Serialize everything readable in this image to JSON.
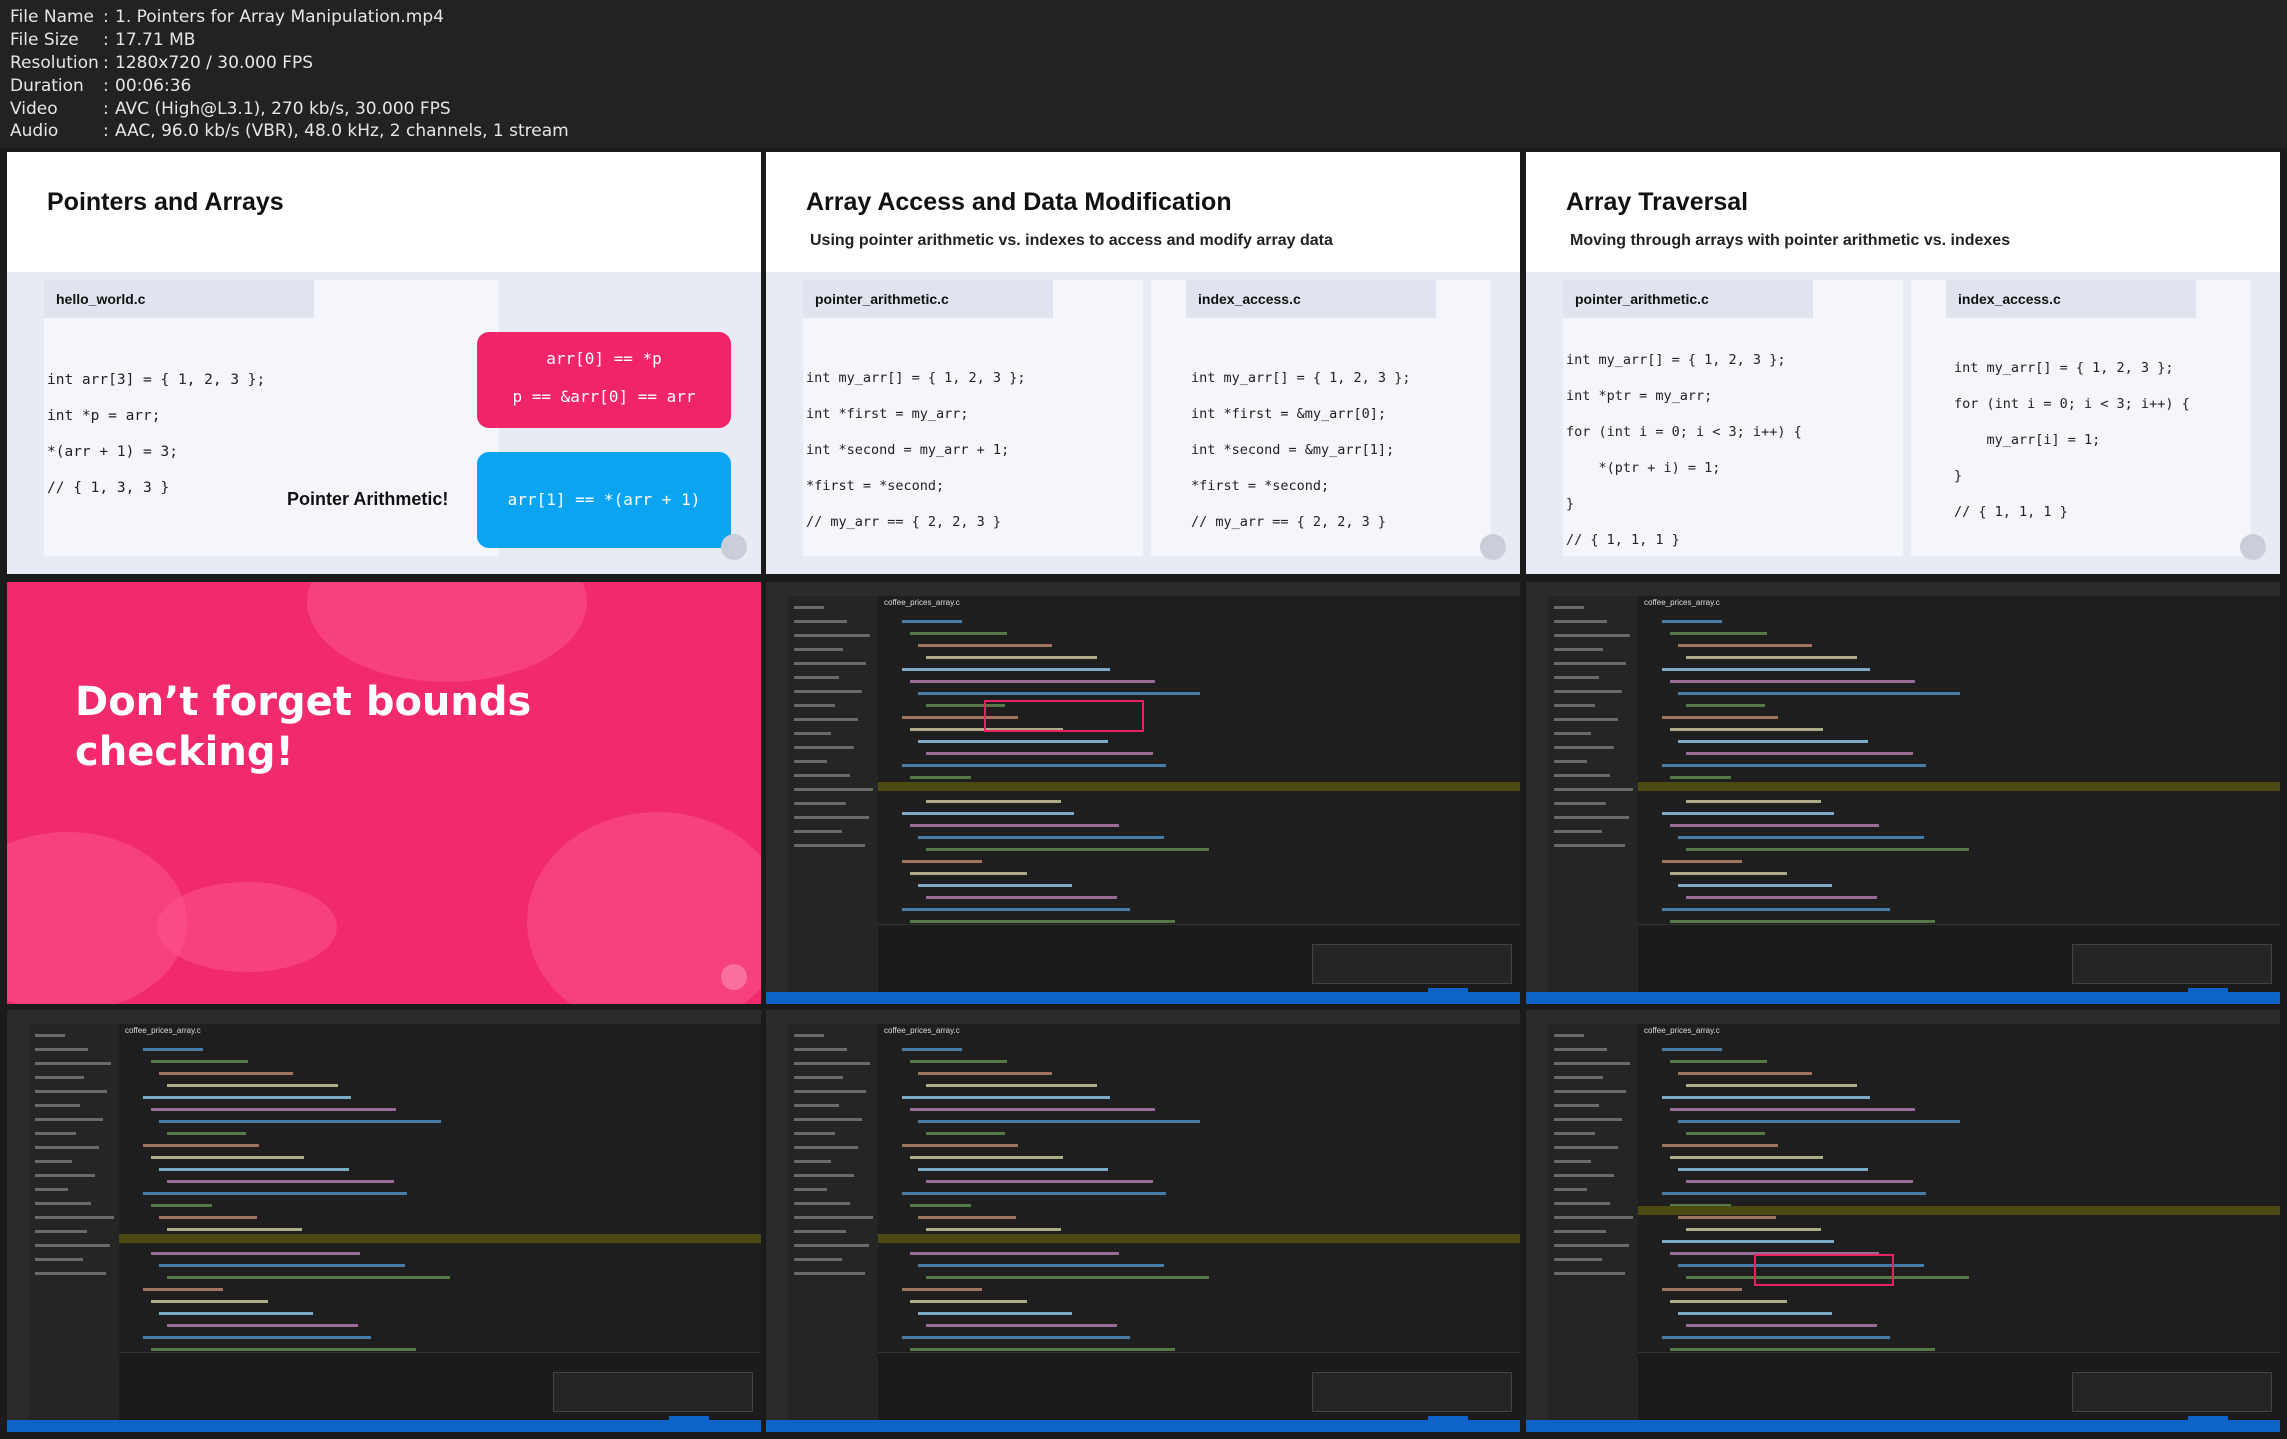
{
  "metadata": {
    "rows": [
      {
        "key": "File Name",
        "value": "1. Pointers for Array Manipulation.mp4"
      },
      {
        "key": "File Size",
        "value": "17.71 MB"
      },
      {
        "key": "Resolution",
        "value": "1280x720 / 30.000 FPS"
      },
      {
        "key": "Duration",
        "value": "00:06:36"
      },
      {
        "key": "Video",
        "value": "AVC (High@L3.1), 270 kb/s, 30.000 FPS"
      },
      {
        "key": "Audio",
        "value": "AAC, 96.0 kb/s (VBR), 48.0 kHz, 2 channels, 1 stream"
      }
    ]
  },
  "slide1": {
    "title": "Pointers and Arrays",
    "tab": "hello_world.c",
    "code": [
      "int arr[3] = { 1, 2, 3 };",
      "int *p = arr;",
      "*(arr + 1) = 3;",
      "// { 1, 3, 3 }"
    ],
    "box_pink_1": "arr[0] == *p",
    "box_pink_2": "p == &arr[0] == arr",
    "box_blue": "arr[1] == *(arr + 1)",
    "label": "Pointer Arithmetic!",
    "colors": {
      "pink": "#f0246a",
      "blue": "#0aa4f0"
    }
  },
  "slide2": {
    "title": "Array Access and Data Modification",
    "subtitle": "Using pointer arithmetic vs. indexes to access and modify array data",
    "tab_left": "pointer_arithmetic.c",
    "tab_right": "index_access.c",
    "code_left": [
      "int my_arr[] = { 1, 2, 3 };",
      "int *first = my_arr;",
      "int *second = my_arr + 1;",
      "*first = *second;",
      "// my_arr == { 2, 2, 3 }"
    ],
    "code_right": [
      "int my_arr[] = { 1, 2, 3 };",
      "int *first = &my_arr[0];",
      "int *second = &my_arr[1];",
      "*first = *second;",
      "// my_arr == { 2, 2, 3 }"
    ]
  },
  "slide3": {
    "title": "Array Traversal",
    "subtitle": "Moving through arrays with pointer arithmetic vs. indexes",
    "tab_left": "pointer_arithmetic.c",
    "tab_right": "index_access.c",
    "code_left": [
      "int my_arr[] = { 1, 2, 3 };",
      "int *ptr = my_arr;",
      "for (int i = 0; i < 3; i++) {",
      "    *(ptr + i) = 1;",
      "}",
      "// { 1, 1, 1 }"
    ],
    "code_right": [
      "int my_arr[] = { 1, 2, 3 };",
      "for (int i = 0; i < 3; i++) {",
      "    my_arr[i] = 1;",
      "}",
      "// { 1, 1, 1 }"
    ]
  },
  "pink_slide": {
    "line1": "Don’t forget bounds",
    "line2": "checking!",
    "color": "#f02a6c"
  },
  "vscode": {
    "tab": "coffee_prices_array.c",
    "accent": "#0e63c8"
  }
}
